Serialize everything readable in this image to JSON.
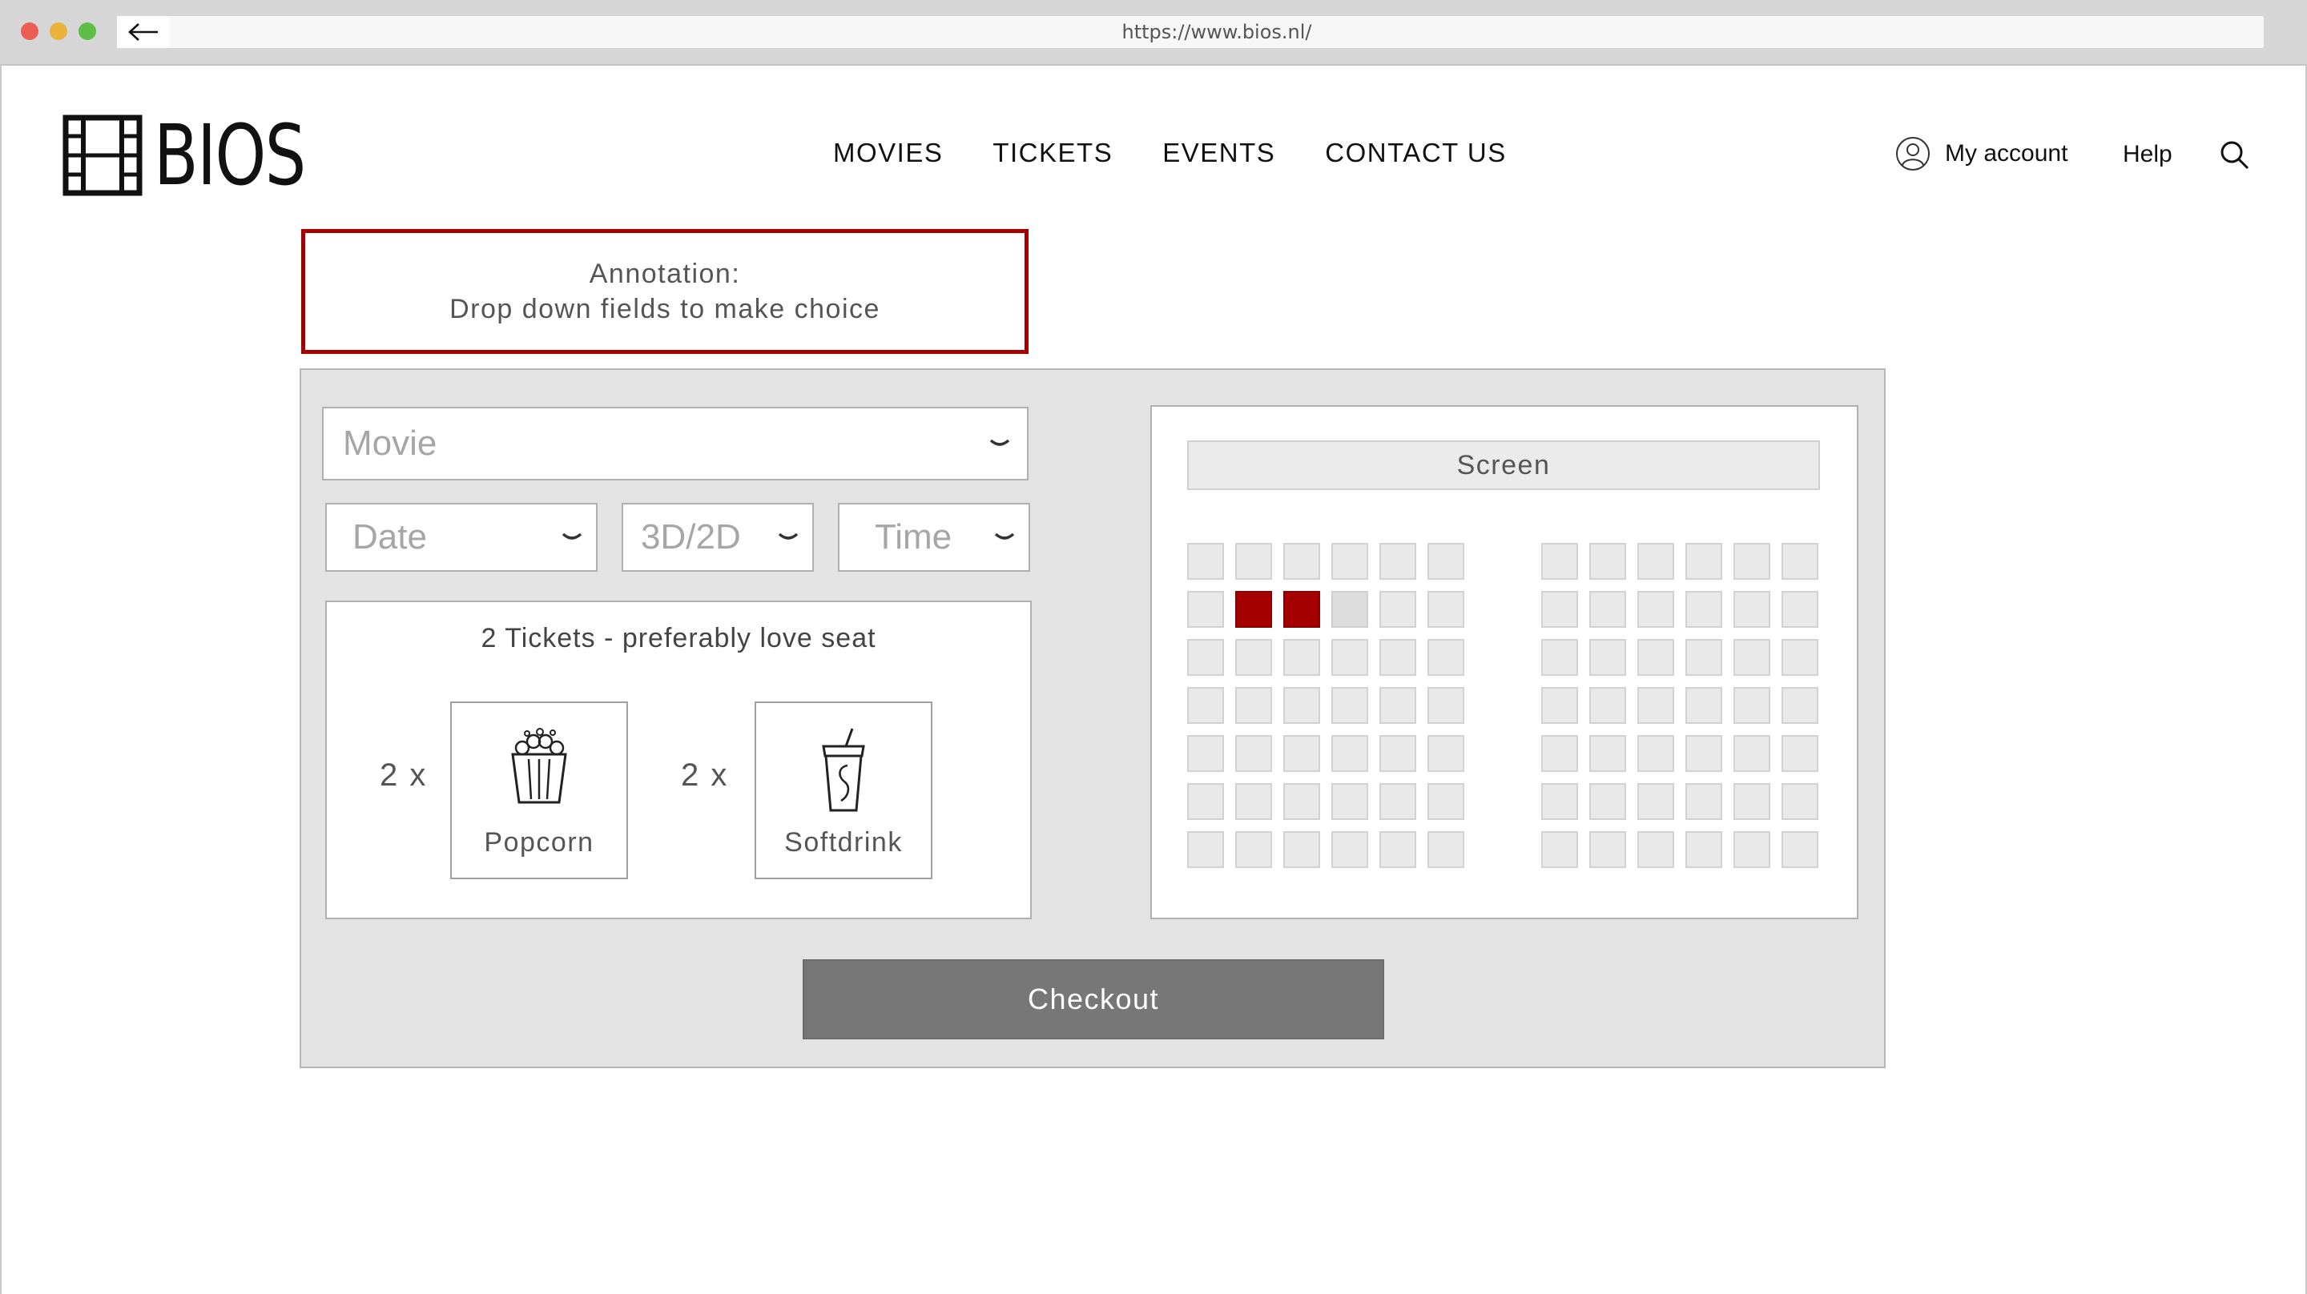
{
  "browser": {
    "url": "https://www.bios.nl/"
  },
  "header": {
    "logo_text": "BIOS",
    "nav": [
      "MOVIES",
      "TICKETS",
      "EVENTS",
      "CONTACT US"
    ],
    "account_label": "My account",
    "help_label": "Help"
  },
  "annotation": {
    "line1": "Annotation:",
    "line2": "Drop down fields to make choice"
  },
  "form": {
    "movie_placeholder": "Movie",
    "date_placeholder": "Date",
    "format_placeholder": "3D/2D",
    "time_placeholder": "Time"
  },
  "tickets": {
    "title": "2 Tickets - preferably love seat",
    "items": [
      {
        "qty": "2 x",
        "label": "Popcorn",
        "icon": "popcorn-icon"
      },
      {
        "qty": "2 x",
        "label": "Softdrink",
        "icon": "softdrink-icon"
      }
    ]
  },
  "seatmap": {
    "screen_label": "Screen",
    "rows": 7,
    "cols_per_block": 6,
    "selected_seats": [
      {
        "block": "left",
        "row": 2,
        "col": 2
      },
      {
        "block": "left",
        "row": 2,
        "col": 3
      }
    ],
    "taken_seats": [
      {
        "block": "left",
        "row": 2,
        "col": 4
      }
    ],
    "colors": {
      "selected": "#a40000",
      "available": "#e9e9e9"
    }
  },
  "checkout_label": "Checkout"
}
